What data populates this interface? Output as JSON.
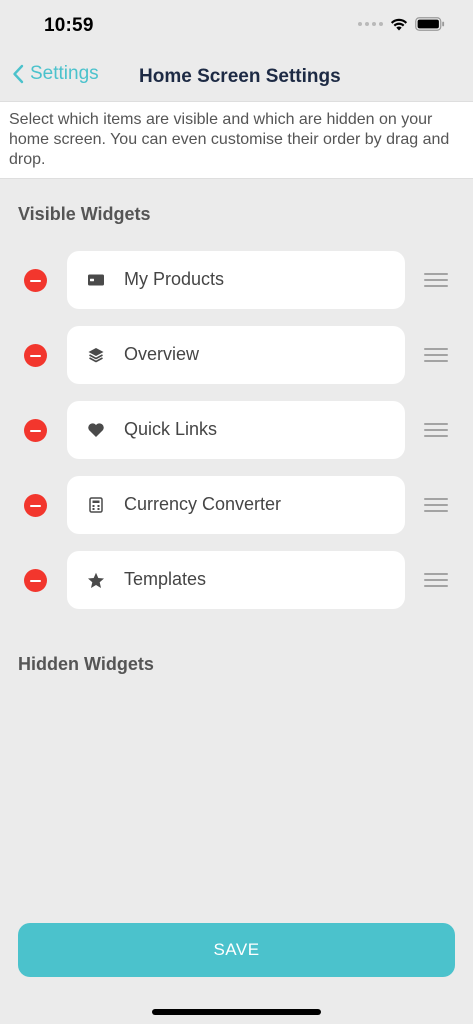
{
  "status_bar": {
    "time": "10:59"
  },
  "nav": {
    "back_label": "Settings",
    "title": "Home Screen Settings"
  },
  "description": "Select which items are visible and which are hidden on your home screen. You can even customise their order by drag and drop.",
  "visible_section": {
    "title": "Visible Widgets",
    "items": [
      {
        "label": "My Products",
        "icon": "wallet-icon"
      },
      {
        "label": "Overview",
        "icon": "layers-icon"
      },
      {
        "label": "Quick Links",
        "icon": "heart-icon"
      },
      {
        "label": "Currency Converter",
        "icon": "calculator-icon"
      },
      {
        "label": "Templates",
        "icon": "star-icon"
      }
    ]
  },
  "hidden_section": {
    "title": "Hidden Widgets",
    "items": []
  },
  "save_label": "SAVE",
  "colors": {
    "accent": "#4bc2cc",
    "remove": "#f2362d",
    "title": "#1d2a44"
  }
}
